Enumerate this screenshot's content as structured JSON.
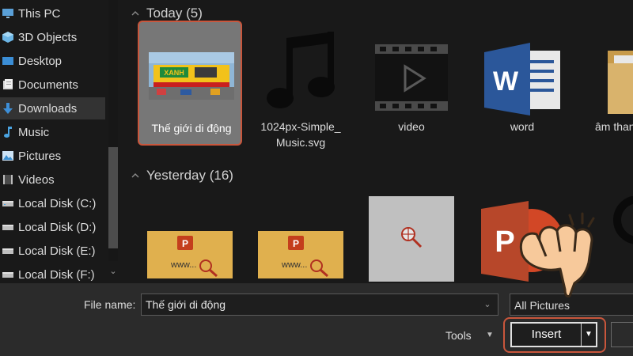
{
  "sidebar": {
    "items": [
      {
        "label": "This PC",
        "icon": "this-pc-icon"
      },
      {
        "label": "3D Objects",
        "icon": "3d-objects-icon"
      },
      {
        "label": "Desktop",
        "icon": "desktop-icon"
      },
      {
        "label": "Documents",
        "icon": "documents-icon"
      },
      {
        "label": "Downloads",
        "icon": "downloads-icon",
        "selected": true
      },
      {
        "label": "Music",
        "icon": "music-icon"
      },
      {
        "label": "Pictures",
        "icon": "pictures-icon"
      },
      {
        "label": "Videos",
        "icon": "videos-icon"
      },
      {
        "label": "Local Disk (C:)",
        "icon": "drive-icon"
      },
      {
        "label": "Local Disk (D:)",
        "icon": "drive-icon"
      },
      {
        "label": "Local Disk (E:)",
        "icon": "drive-icon"
      },
      {
        "label": "Local Disk (F:)",
        "icon": "drive-icon"
      }
    ]
  },
  "groups": {
    "today": {
      "header": "Today (5)",
      "files": [
        {
          "name": "Thế giới di động",
          "kind": "photo",
          "selected": true
        },
        {
          "name": "1024px-Simple_Music.svg",
          "name_line1": "1024px-Simple_",
          "name_line2": "Music.svg",
          "kind": "music-note"
        },
        {
          "name": "video",
          "kind": "video-file"
        },
        {
          "name": "word",
          "kind": "word-document"
        },
        {
          "name": "âm thanh",
          "kind": "folder"
        }
      ]
    },
    "yesterday": {
      "header": "Yesterday (16)",
      "files": [
        {
          "kind": "powerpoint-web-thumbnail",
          "text": "www..."
        },
        {
          "kind": "powerpoint-web-thumbnail",
          "text": "www..."
        },
        {
          "kind": "web-search-thumbnail"
        },
        {
          "kind": "powerpoint-icon"
        },
        {
          "kind": "circle-icon"
        }
      ]
    }
  },
  "photo_sign": {
    "brand": "XANH"
  },
  "bottom": {
    "filename_label": "File name:",
    "filename_value": "Thế giới di động",
    "filetype_value": "All Pictures",
    "tools_label": "Tools",
    "insert_label": "Insert"
  },
  "colors": {
    "background": "#191919",
    "bottom_bar": "#2b2b2b",
    "highlight_outline": "#c9563c",
    "selected_tile": "#777777",
    "word_blue": "#2b579a",
    "powerpoint_red": "#c43e1c",
    "folder_tan": "#d9b36c"
  }
}
